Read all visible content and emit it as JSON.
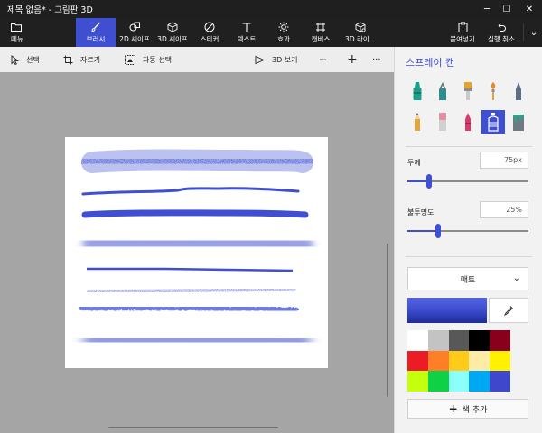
{
  "window": {
    "title": "제목 없음* - 그림판 3D",
    "minimize": "─",
    "maximize": "☐",
    "close": "✕"
  },
  "toolbar": {
    "menu": "메뉴",
    "tools": [
      {
        "id": "brushes",
        "label": "브러시",
        "active": true
      },
      {
        "id": "2d-shapes",
        "label": "2D 셰이프"
      },
      {
        "id": "3d-shapes",
        "label": "3D 셰이프"
      },
      {
        "id": "stickers",
        "label": "스티커"
      },
      {
        "id": "text",
        "label": "텍스트"
      },
      {
        "id": "effects",
        "label": "효과"
      },
      {
        "id": "canvas",
        "label": "캔버스"
      },
      {
        "id": "3d-library",
        "label": "3D 라이..."
      }
    ],
    "paste": "붙여넣기",
    "undo": "실행 취소",
    "more": "⌄"
  },
  "subbar": {
    "select": "선택",
    "crop": "자르기",
    "magic_select": "자동 선택",
    "view_3d": "3D 보기",
    "zoom_out": "─",
    "zoom_in": "+",
    "more": "···"
  },
  "panel": {
    "title": "스프레이 캔",
    "brushes": [
      {
        "name": "marker",
        "color": "#1aa08a"
      },
      {
        "name": "calligraphy-pen",
        "color": "#2c8e8e"
      },
      {
        "name": "oil-brush",
        "color": "#e2a431"
      },
      {
        "name": "watercolor",
        "color": "#e48a2e"
      },
      {
        "name": "pixel-pen",
        "color": "#5c6f86"
      },
      {
        "name": "pencil",
        "color": "#e1a53b"
      },
      {
        "name": "eraser",
        "color": "#e58fa5"
      },
      {
        "name": "crayon",
        "color": "#d93a6b"
      },
      {
        "name": "spray-can",
        "color": "#3e4fd1",
        "active": true
      },
      {
        "name": "fill",
        "color": "#2aa58a"
      }
    ],
    "thickness": {
      "label": "두께",
      "value": "75px",
      "level": 0.18
    },
    "opacity": {
      "label": "불투명도",
      "value": "25%",
      "level": 0.25
    },
    "material": "매트",
    "current_color": "#3e4fd1",
    "palette": [
      "#ffffff",
      "#c3c3c3",
      "#585858",
      "#000000",
      "#88001b",
      "#ec1c24",
      "#ff7f27",
      "#ffca18",
      "#fdeca6",
      "#fff200",
      "#c4ff0e",
      "#0ed145",
      "#8cfffb",
      "#00a8f3",
      "#3f48cc"
    ],
    "add_color": "색 추가"
  },
  "colors": {
    "accent": "#3e4fd1",
    "stroke": "#3e4fd1"
  }
}
